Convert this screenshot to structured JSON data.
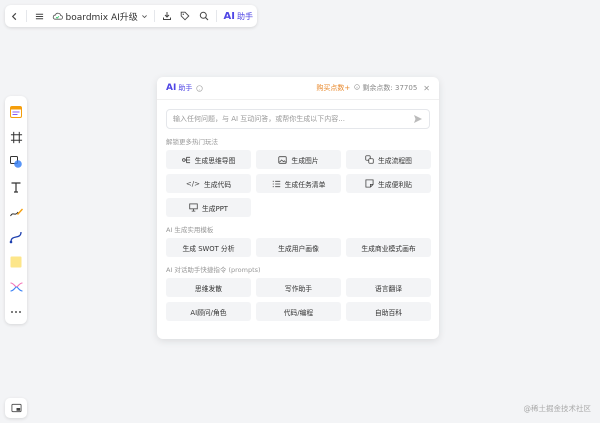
{
  "topbar": {
    "doc_title": "boardmix AI升级",
    "ai_logo": "AI",
    "ai_label": "助手"
  },
  "leftbar": {
    "tools": [
      "template-icon",
      "frame-icon",
      "shape-icon",
      "text-icon",
      "pen-icon",
      "connector-icon",
      "sticky-note-icon",
      "mindmap-icon",
      "more-icon"
    ]
  },
  "panel": {
    "logo": "AI",
    "title": "助手",
    "buy_points": "购买点数",
    "remaining_points": "剩余点数: 37705",
    "input_placeholder": "输入任何问题，与 AI 互动问答，或帮你生成以下内容...",
    "sections": [
      {
        "title": "解锁更多热门玩法",
        "items": [
          {
            "icon": "mindmap-icon",
            "label": "生成思维导图"
          },
          {
            "icon": "image-icon",
            "label": "生成图片"
          },
          {
            "icon": "flowchart-icon",
            "label": "生成流程图"
          },
          {
            "icon": "code-icon",
            "label": "生成代码"
          },
          {
            "icon": "checklist-icon",
            "label": "生成任务清单"
          },
          {
            "icon": "sticky-note-icon",
            "label": "生成便利贴"
          },
          {
            "icon": "presentation-icon",
            "label": "生成PPT"
          }
        ]
      },
      {
        "title": "AI 生成实用模板",
        "items": [
          {
            "label": "生成 SWOT 分析"
          },
          {
            "label": "生成用户画像"
          },
          {
            "label": "生成商业模式画布"
          }
        ]
      },
      {
        "title": "AI 对话助手快捷指令 (prompts)",
        "items": [
          {
            "label": "思维发散"
          },
          {
            "label": "写作助手"
          },
          {
            "label": "语言翻译"
          },
          {
            "label": "AI顾问/角色"
          },
          {
            "label": "代码/编程"
          },
          {
            "label": "自助百科"
          }
        ]
      }
    ]
  },
  "watermark": "@稀土掘金技术社区"
}
